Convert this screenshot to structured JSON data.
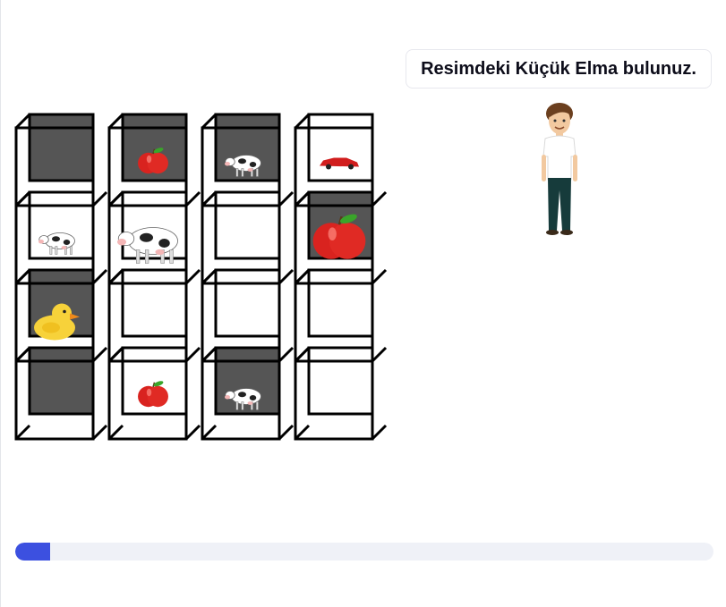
{
  "instruction": {
    "text": "Resimdeki Küçük Elma bulunuz."
  },
  "colors": {
    "accent": "#3c50e0",
    "track": "#eff1f7",
    "dark_cell": "#555555"
  },
  "progress": {
    "fraction": 0.05
  },
  "grid": {
    "rows": [
      [
        {
          "shade": "dark",
          "item": "none",
          "size": "none"
        },
        {
          "shade": "dark",
          "item": "apple",
          "size": "small"
        },
        {
          "shade": "dark",
          "item": "cow",
          "size": "small"
        },
        {
          "shade": "light",
          "item": "car",
          "size": "small"
        }
      ],
      [
        {
          "shade": "light",
          "item": "cow",
          "size": "small"
        },
        {
          "shade": "light",
          "item": "cow",
          "size": "large"
        },
        {
          "shade": "light",
          "item": "none",
          "size": "none"
        },
        {
          "shade": "dark",
          "item": "apple",
          "size": "large"
        }
      ],
      [
        {
          "shade": "dark",
          "item": "duck",
          "size": "large"
        },
        {
          "shade": "light",
          "item": "none",
          "size": "none"
        },
        {
          "shade": "light",
          "item": "none",
          "size": "none"
        },
        {
          "shade": "light",
          "item": "none",
          "size": "none"
        }
      ],
      [
        {
          "shade": "dark",
          "item": "none",
          "size": "none"
        },
        {
          "shade": "light",
          "item": "apple",
          "size": "small"
        },
        {
          "shade": "dark",
          "item": "cow",
          "size": "small"
        },
        {
          "shade": "light",
          "item": "none",
          "size": "none"
        }
      ]
    ]
  },
  "icons": {
    "avatar": "standing-boy-avatar-icon"
  }
}
